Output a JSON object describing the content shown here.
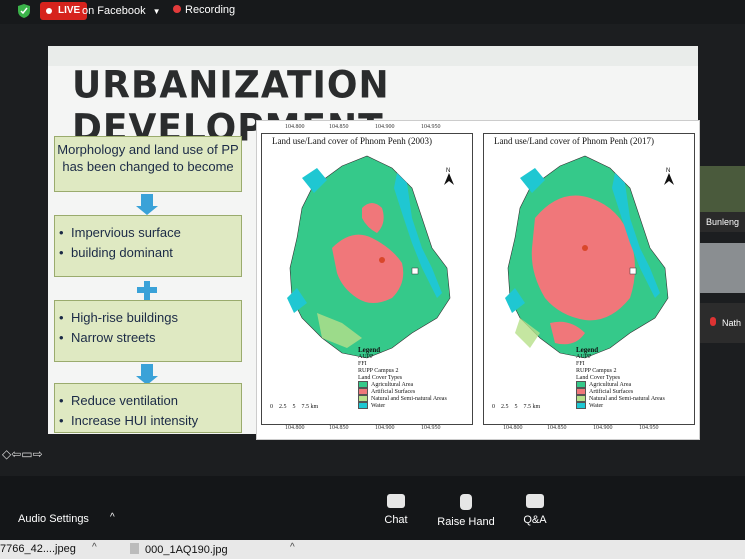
{
  "topbar": {
    "live_label": "LIVE",
    "stream_target": "on Facebook",
    "recording_label": "Recording"
  },
  "slide": {
    "title": "URBANIZATION DEVELOPMENT",
    "flow": [
      {
        "type": "text",
        "text": "Morphology and land use of PP has been changed to become"
      },
      {
        "type": "bullets",
        "items": [
          "Impervious surface",
          "building dominant"
        ]
      },
      {
        "type": "bullets",
        "items": [
          "High-rise buildings",
          "Narrow streets"
        ]
      },
      {
        "type": "bullets",
        "items": [
          "Reduce ventilation",
          "Increase HUI intensity"
        ]
      }
    ],
    "maps": [
      {
        "title": "Land use/Land cover of Phnom Penh (2003)",
        "top_ticks": [
          "104.800",
          "104.850",
          "104.900",
          "104.950"
        ],
        "bottom_ticks": [
          "104.800",
          "104.850",
          "104.900",
          "104.950"
        ],
        "left_ticks": [
          "11.650",
          "11.600",
          "11.550",
          "11.500",
          "11.450",
          "11.400"
        ],
        "scale": [
          "0",
          "2.5",
          "5",
          "7.5 km"
        ]
      },
      {
        "title": "Land use/Land cover of Phnom Penh (2017)",
        "top_ticks": [
          "104.800",
          "104.850",
          "104.900",
          "104.950"
        ],
        "bottom_ticks": [
          "104.800",
          "104.850",
          "104.900",
          "104.950"
        ],
        "left_ticks": [
          "11.650",
          "11.600",
          "11.550",
          "11.500",
          "11.450",
          "11.400"
        ],
        "scale": [
          "0",
          "2.5",
          "5",
          "7.5 km"
        ]
      }
    ],
    "legend": {
      "title": "Legend",
      "points": [
        "AUPP",
        "FFI",
        "RUPP Campus 2"
      ],
      "types_title": "Land Cover Types",
      "types": [
        {
          "label": "Agricultural Area",
          "color": "#35c98a"
        },
        {
          "label": "Artificial Surfaces",
          "color": "#f0777a"
        },
        {
          "label": "Natural and Semi-natural Areas",
          "color": "#b7e08a"
        },
        {
          "label": "Water",
          "color": "#1fc7d2"
        }
      ]
    },
    "colors": {
      "box_fill": "#dfe9c2",
      "arrow": "#3aa2d8",
      "agri": "#35c98a",
      "urban": "#f0777a",
      "natural": "#b7e08a",
      "water": "#1fc7d2"
    }
  },
  "participants": [
    {
      "name": "Bunleng"
    },
    {
      "name": "Nath"
    }
  ],
  "controls": {
    "audio_settings": "Audio Settings",
    "chat": "Chat",
    "raise_hand": "Raise Hand",
    "qa": "Q&A"
  },
  "downloads": [
    {
      "name": "7766_42....jpeg"
    },
    {
      "name": "000_1AQ190.jpg"
    }
  ],
  "icons": {
    "shield": "shield-icon",
    "recording": "record-dot-icon",
    "north_arrow": "north-arrow-icon"
  }
}
